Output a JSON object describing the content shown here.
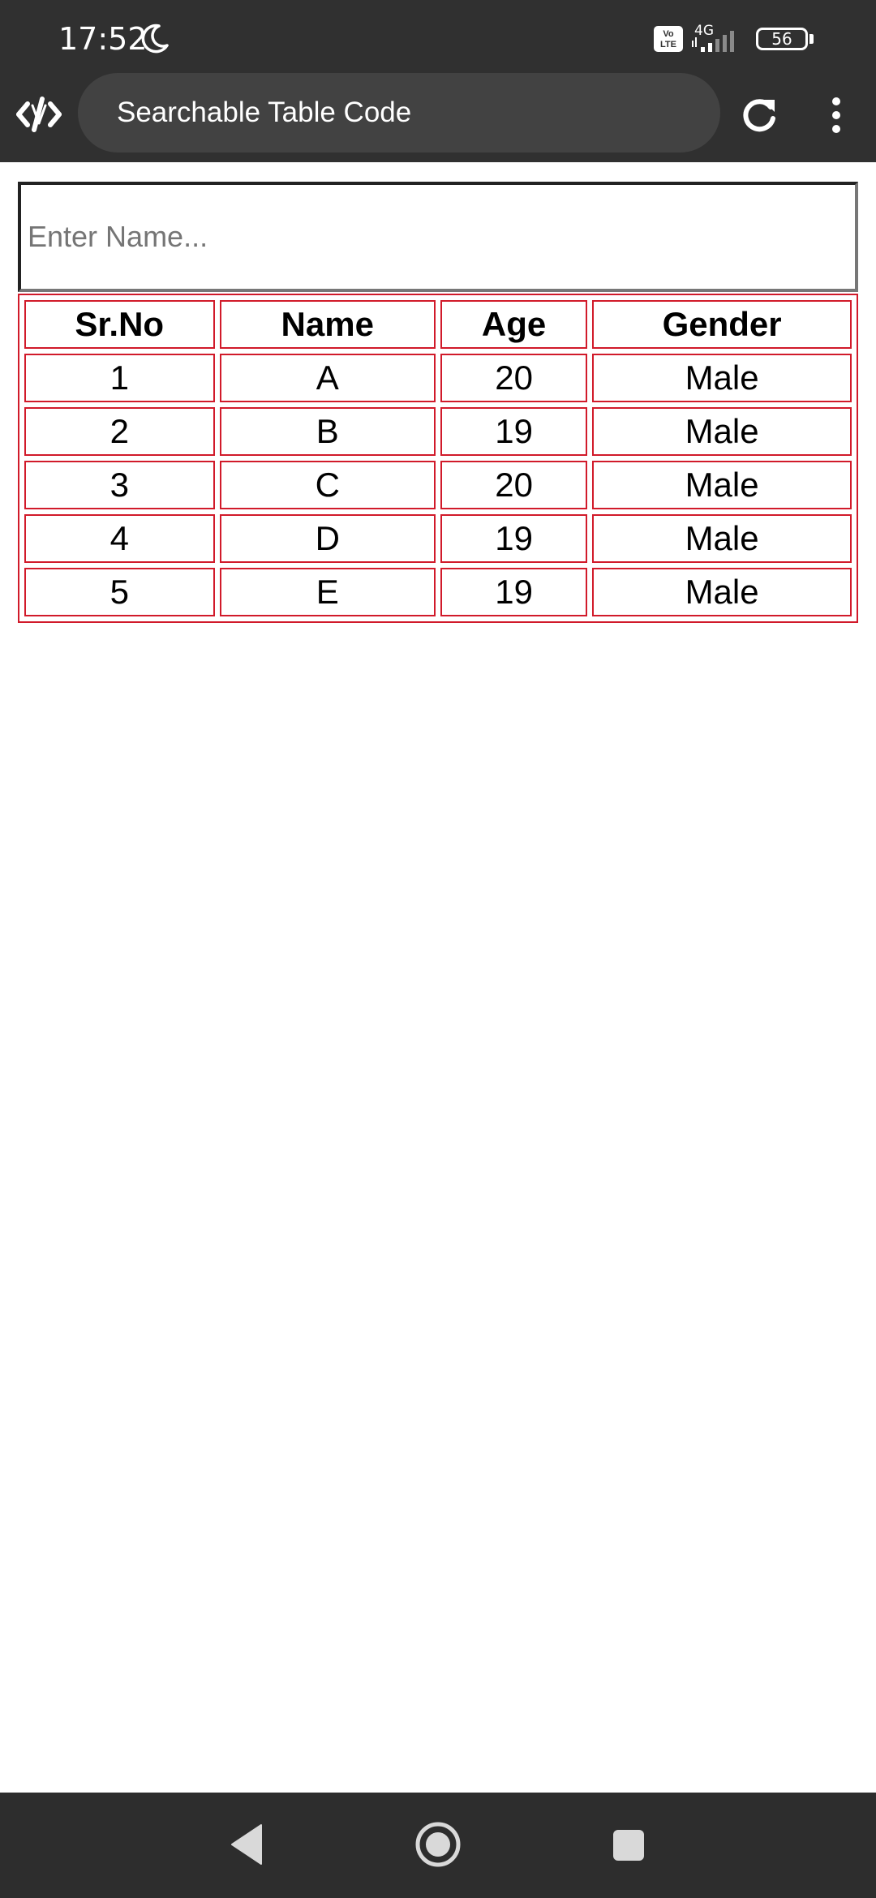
{
  "status_bar": {
    "time": "17:52",
    "network": "4G",
    "volte": "Vo LTE",
    "battery": "56",
    "icons": [
      "moon-icon",
      "volte-icon",
      "signal-icon",
      "battery-icon"
    ]
  },
  "browser": {
    "title": "Searchable Table Code",
    "icons": [
      "app-logo-icon",
      "refresh-icon",
      "more-vert-icon"
    ]
  },
  "search": {
    "placeholder": "Enter Name...",
    "value": ""
  },
  "table": {
    "headers": [
      "Sr.No",
      "Name",
      "Age",
      "Gender"
    ],
    "rows": [
      [
        "1",
        "A",
        "20",
        "Male"
      ],
      [
        "2",
        "B",
        "19",
        "Male"
      ],
      [
        "3",
        "C",
        "20",
        "Male"
      ],
      [
        "4",
        "D",
        "19",
        "Male"
      ],
      [
        "5",
        "E",
        "19",
        "Male"
      ]
    ],
    "border_color": "#d11a2a"
  },
  "colors": {
    "bar_background": "#303030",
    "title_pill": "#424242",
    "nav_background": "#2d2d2d"
  },
  "nav_bar": {
    "icons": [
      "back-icon",
      "home-icon",
      "recents-icon"
    ]
  }
}
